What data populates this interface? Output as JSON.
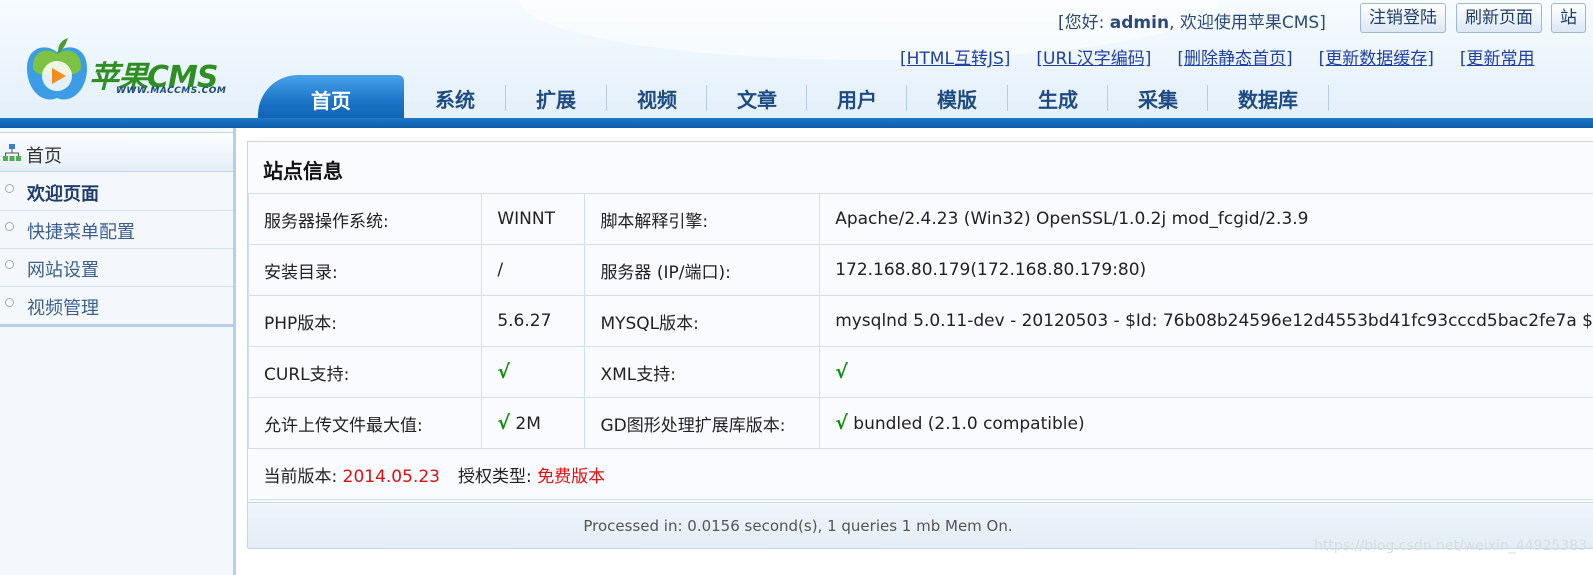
{
  "header": {
    "logo_text": "苹果CMS",
    "logo_sub": "WWW.MACCMS.COM",
    "welcome_prefix": "[您好: ",
    "username": "admin",
    "welcome_suffix": ", 欢迎使用苹果CMS]",
    "buttons": {
      "logout": "注销登陆",
      "refresh": "刷新页面",
      "cut": "站"
    },
    "quick_links": [
      "[HTML互转JS]",
      "[URL汉字编码]",
      "[删除静态首页]",
      "[更新数据缓存]",
      "[更新常用"
    ],
    "nav": [
      "首页",
      "系统",
      "扩展",
      "视频",
      "文章",
      "用户",
      "模版",
      "生成",
      "采集",
      "数据库"
    ]
  },
  "sidebar": {
    "heading": "首页",
    "items": [
      "欢迎页面",
      "快捷菜单配置",
      "网站设置",
      "视频管理"
    ]
  },
  "main": {
    "title": "站点信息",
    "rows": [
      {
        "l1": "服务器操作系统:",
        "v1": "WINNT",
        "l2": "脚本解释引擎:",
        "v2": "Apache/2.4.23 (Win32) OpenSSL/1.0.2j mod_fcgid/2.3.9"
      },
      {
        "l1": "安装目录:",
        "v1": "/",
        "l2": "服务器 (IP/端口):",
        "v2": "172.168.80.179(172.168.80.179:80)"
      },
      {
        "l1": "PHP版本:",
        "v1": "5.6.27",
        "l2": "MYSQL版本:",
        "v2": "mysqlnd 5.0.11-dev - 20120503 - $Id: 76b08b24596e12d4553bd41fc93cccd5bac2fe7a $"
      },
      {
        "l1": "CURL支持:",
        "v1": "√",
        "l2": "XML支持:",
        "v2": "√"
      },
      {
        "l1": "允许上传文件最大值:",
        "v1_check": "√",
        "v1": " 2M",
        "l2": "GD图形处理扩展库版本:",
        "v2_check": "√",
        "v2": " bundled (2.1.0 compatible)"
      }
    ],
    "version_label": "当前版本: ",
    "version": "2014.05.23",
    "license_label": "授权类型: ",
    "license": "免费版本",
    "processed": "Processed in: 0.0156 second(s), 1 queries 1 mb Mem On.",
    "watermark": "https://blog.csdn.net/weixin_44925383"
  },
  "colors": {
    "accent": "#1b74c7",
    "nav_text": "#1e4b82",
    "check": "#0a8f0a",
    "highlight": "#e01010",
    "link": "#1f3fa3"
  }
}
